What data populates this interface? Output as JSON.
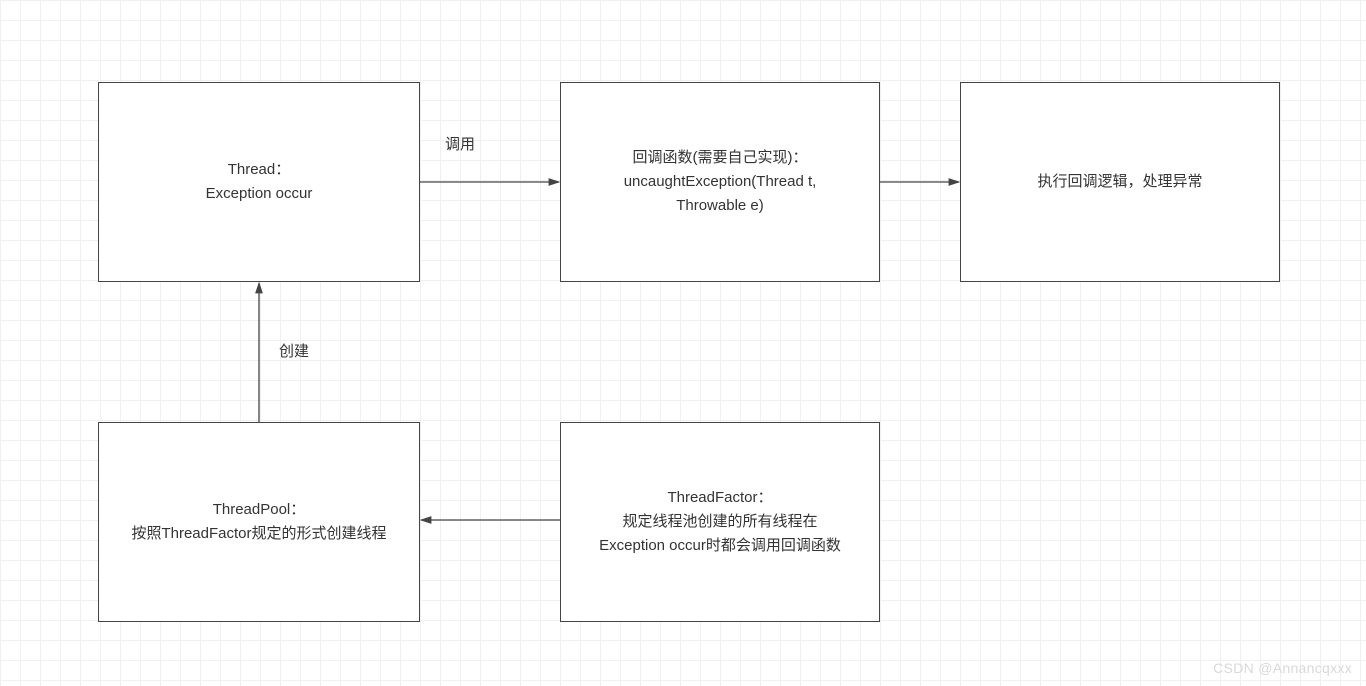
{
  "nodes": {
    "thread": {
      "line1": "Thread：",
      "line2": "Exception occur"
    },
    "callback": {
      "line1": "回调函数(需要自己实现)：",
      "line2": "uncaughtException(Thread t,",
      "line3": "Throwable e)"
    },
    "handler": {
      "line1": "执行回调逻辑，处理异常"
    },
    "threadpool": {
      "line1": "ThreadPool：",
      "line2": "按照ThreadFactor规定的形式创建线程"
    },
    "threadfactor": {
      "line1": "ThreadFactor：",
      "line2": "规定线程池创建的所有线程在",
      "line3": "Exception occur时都会调用回调函数"
    }
  },
  "labels": {
    "call": "调用",
    "create": "创建"
  },
  "watermark": "CSDN @Annancqxxx"
}
